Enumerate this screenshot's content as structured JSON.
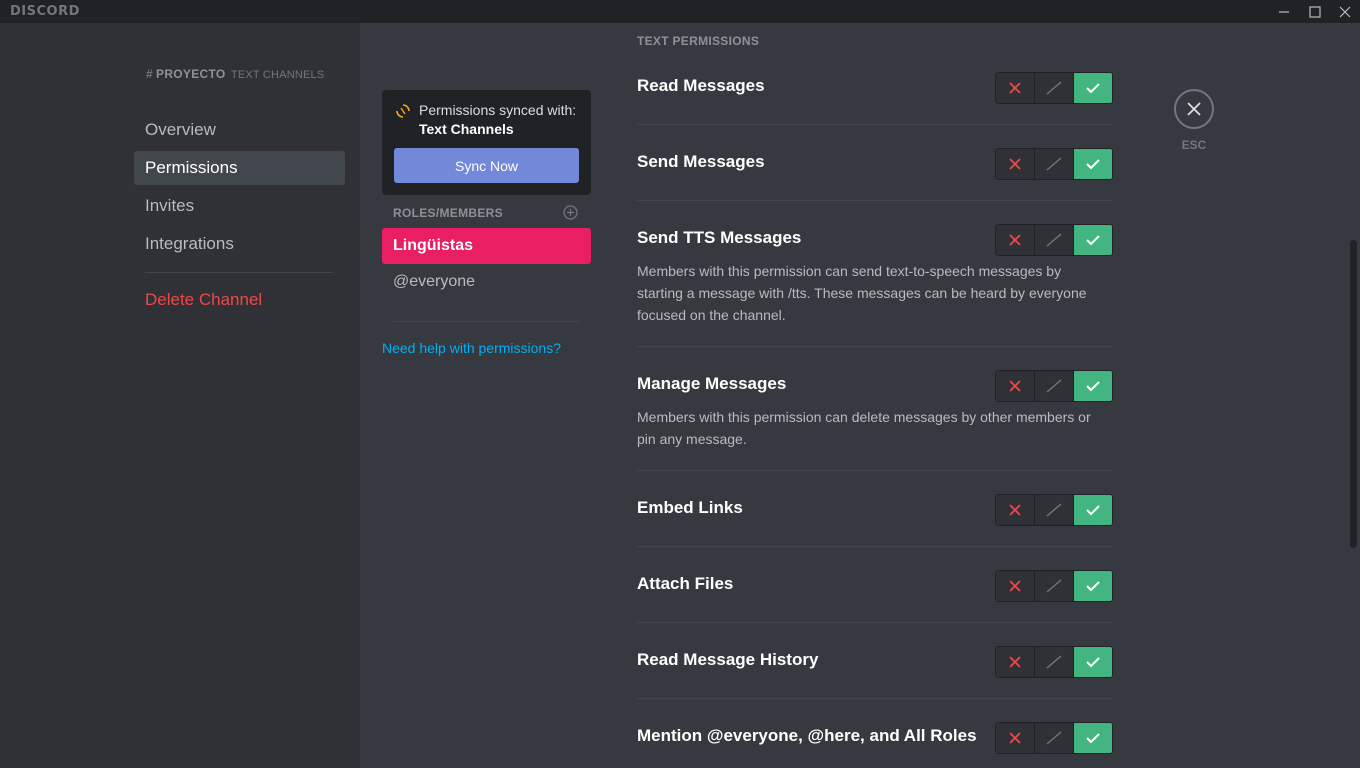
{
  "window": {
    "app_name": "DISCORD"
  },
  "sidebar": {
    "channel_name": "PROYECTO",
    "category": "TEXT CHANNELS",
    "items": [
      {
        "label": "Overview",
        "active": false
      },
      {
        "label": "Permissions",
        "active": true
      },
      {
        "label": "Invites",
        "active": false
      },
      {
        "label": "Integrations",
        "active": false
      }
    ],
    "delete_label": "Delete Channel"
  },
  "sync": {
    "line1": "Permissions synced with:",
    "line2": "Text Channels",
    "button_label": "Sync Now"
  },
  "roles": {
    "header": "ROLES/MEMBERS",
    "items": [
      {
        "label": "Lingüistas",
        "active": true
      },
      {
        "label": "@everyone",
        "active": false
      }
    ],
    "help_link": "Need help with permissions?"
  },
  "permissions": {
    "section_title": "TEXT PERMISSIONS",
    "items": [
      {
        "title": "Read Messages",
        "description": "",
        "state": "allow"
      },
      {
        "title": "Send Messages",
        "description": "",
        "state": "allow"
      },
      {
        "title": "Send TTS Messages",
        "description": "Members with this permission can send text-to-speech messages by starting a message with /tts. These messages can be heard by everyone focused on the channel.",
        "state": "allow"
      },
      {
        "title": "Manage Messages",
        "description": "Members with this permission can delete messages by other members or pin any message.",
        "state": "allow"
      },
      {
        "title": "Embed Links",
        "description": "",
        "state": "allow"
      },
      {
        "title": "Attach Files",
        "description": "",
        "state": "allow"
      },
      {
        "title": "Read Message History",
        "description": "",
        "state": "allow"
      },
      {
        "title": "Mention @everyone, @here, and All Roles",
        "description": "",
        "state": "allow"
      }
    ]
  },
  "close": {
    "label": "ESC"
  },
  "colors": {
    "allow": "#43b581",
    "deny": "#f04747",
    "role_accent": "#e91e63",
    "brand": "#7289da",
    "link": "#00b0f4"
  }
}
